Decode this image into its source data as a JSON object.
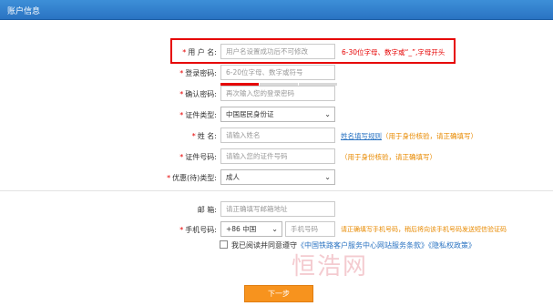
{
  "header": {
    "title": "账户信息"
  },
  "form": {
    "username": {
      "label": "用 户 名:",
      "placeholder": "用户名设置成功后不可修改",
      "hint": "6-30位字母、数字或“_”,字母开头"
    },
    "password": {
      "label": "登录密码:",
      "placeholder": "6-20位字母、数字或符号"
    },
    "confirm": {
      "label": "确认密码:",
      "placeholder": "再次输入您的登录密码"
    },
    "id_type": {
      "label": "证件类型:",
      "value": "中国居民身份证"
    },
    "name": {
      "label": "姓    名:",
      "placeholder": "请输入姓名",
      "hint_link": "姓名填写规则",
      "hint": "（用于身份核验，请正确填写）"
    },
    "id_number": {
      "label": "证件号码:",
      "placeholder": "请输入您的证件号码",
      "hint": "（用于身份核验，请正确填写）"
    },
    "passenger_type": {
      "label": "优惠(待)类型:",
      "value": "成人"
    },
    "email": {
      "label": "邮 箱:",
      "placeholder": "请正确填写邮箱地址"
    },
    "phone": {
      "label": "手机号码:",
      "country": "+86 中国",
      "placeholder": "手机号码",
      "hint": "请正确填写手机号码，稍后将向该手机号码发送短信验证码"
    }
  },
  "agreement": {
    "text": "我已阅读并同意遵守",
    "link1": "《中国铁路客户服务中心网站服务条款》",
    "link2": "《隐私权政策》"
  },
  "watermark": "恒浩网",
  "next_button": "下一步",
  "colors": {
    "header": "#2a73c2",
    "required": "#e60000",
    "hint_orange": "#e88a00",
    "button": "#f7931e"
  }
}
